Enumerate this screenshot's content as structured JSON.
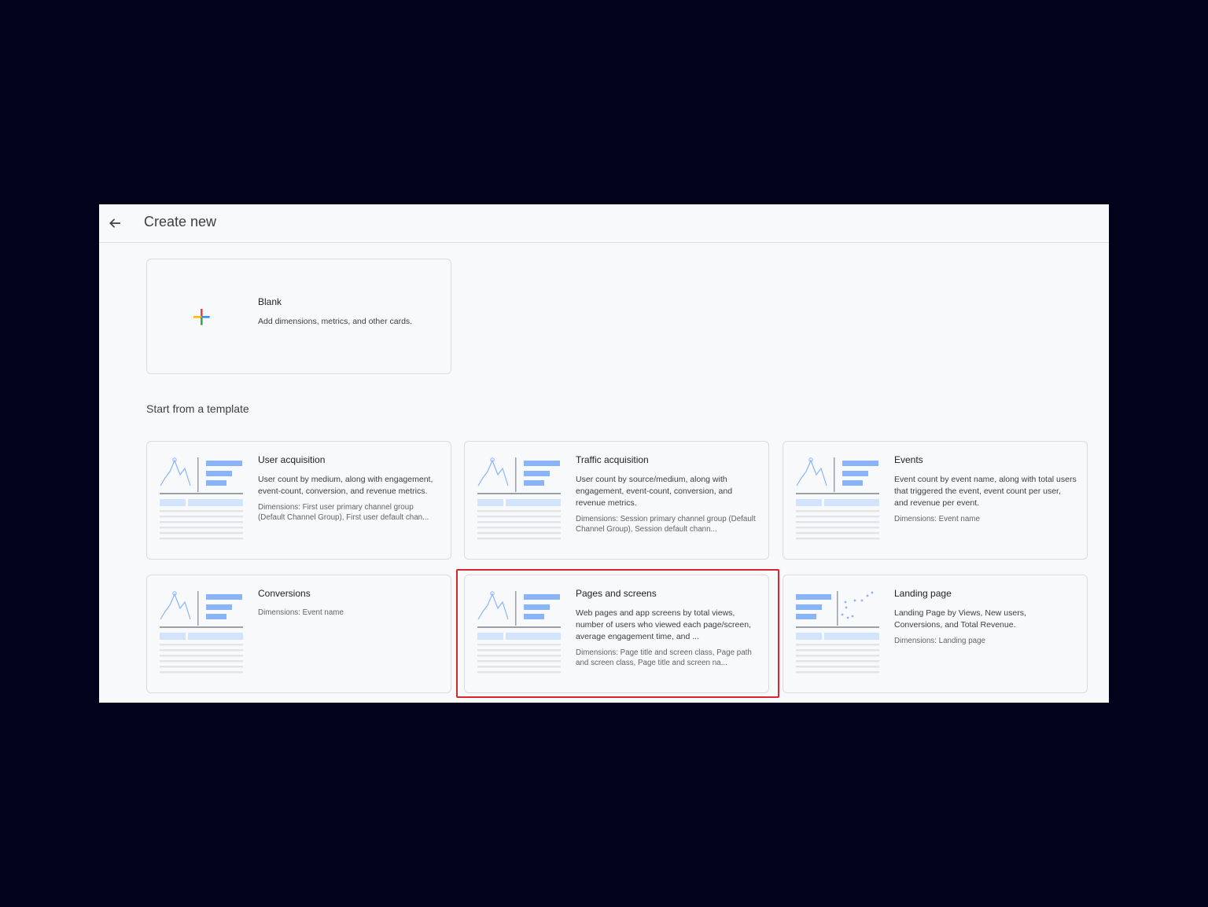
{
  "header": {
    "back_label": "Back",
    "title": "Create new"
  },
  "blank": {
    "title": "Blank",
    "description": "Add dimensions, metrics, and other cards."
  },
  "section_title": "Start from a template",
  "templates": [
    {
      "title": "User acquisition",
      "description": "User count by medium, along with engagement, event-count, conversion, and revenue metrics.",
      "dimensions": "Dimensions: First user primary channel group (Default Channel Group), First user default chan..."
    },
    {
      "title": "Traffic acquisition",
      "description": "User count by source/medium, along with engagement, event-count, conversion, and revenue metrics.",
      "dimensions": "Dimensions: Session primary channel group (Default Channel Group), Session default chann..."
    },
    {
      "title": "Events",
      "description": "Event count by event name, along with total users that triggered the event, event count per user, and revenue per event.",
      "dimensions": "Dimensions: Event name"
    },
    {
      "title": "Conversions",
      "description": "",
      "dimensions": "Dimensions: Event name"
    },
    {
      "title": "Pages and screens",
      "description": "Web pages and app screens by total views, number of users who viewed each page/screen, average engagement time, and ...",
      "dimensions": "Dimensions: Page title and screen class, Page path and screen class, Page title and screen na..."
    },
    {
      "title": "Landing page",
      "description": "Landing Page by Views, New users, Conversions, and Total Revenue.",
      "dimensions": "Dimensions: Landing page"
    }
  ],
  "colors": {
    "accent_blue": "#8ab4f8",
    "light_blue": "#d2e3fc",
    "highlight_red": "#d8262e"
  }
}
